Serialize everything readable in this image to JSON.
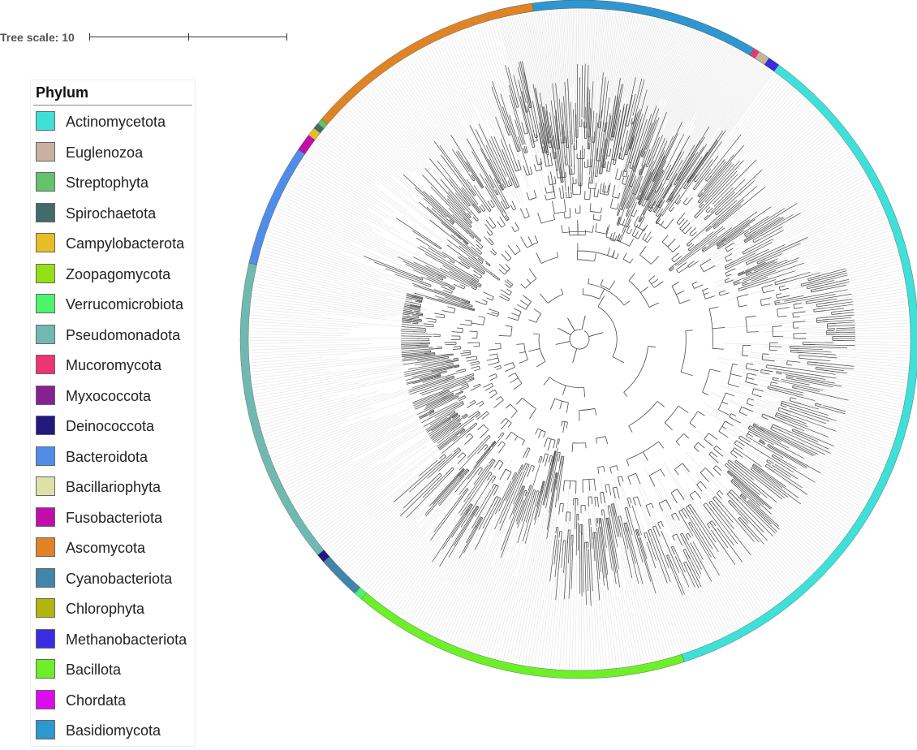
{
  "scale": {
    "label": "Tree scale: 10"
  },
  "legend": {
    "title": "Phylum",
    "items": [
      {
        "label": "Actinomycetota",
        "color": "#3ee0d8"
      },
      {
        "label": "Euglenozoa",
        "color": "#c7b29f"
      },
      {
        "label": "Streptophyta",
        "color": "#64c26a"
      },
      {
        "label": "Spirochaetota",
        "color": "#426b6b"
      },
      {
        "label": "Campylobacterota",
        "color": "#e6bd26"
      },
      {
        "label": "Zoopagomycota",
        "color": "#93e016"
      },
      {
        "label": "Verrucomicrobiota",
        "color": "#4cf46a"
      },
      {
        "label": "Pseudomonadota",
        "color": "#70b9b1"
      },
      {
        "label": "Mucoromycota",
        "color": "#ec3573"
      },
      {
        "label": "Myxococcota",
        "color": "#852292"
      },
      {
        "label": "Deinococcota",
        "color": "#24187d"
      },
      {
        "label": "Bacteroidota",
        "color": "#4f8de9"
      },
      {
        "label": "Bacillariophyta",
        "color": "#dee1a7"
      },
      {
        "label": "Fusobacteriota",
        "color": "#bf0ea9"
      },
      {
        "label": "Ascomycota",
        "color": "#df8327"
      },
      {
        "label": "Cyanobacteriota",
        "color": "#4185aa"
      },
      {
        "label": "Chlorophyta",
        "color": "#b4b40e"
      },
      {
        "label": "Methanobacteriota",
        "color": "#3a2ce0"
      },
      {
        "label": "Bacillota",
        "color": "#6def2a"
      },
      {
        "label": "Chordata",
        "color": "#dc0cec"
      },
      {
        "label": "Basidiomycota",
        "color": "#2e97d0"
      }
    ]
  },
  "ring_segments": [
    {
      "phylum": "Actinomycetota",
      "start_deg": 256,
      "end_deg": 432
    },
    {
      "phylum": "Bacillota",
      "start_deg": 432,
      "end_deg": 490
    },
    {
      "phylum": "Verrucomicrobiota",
      "start_deg": 490,
      "end_deg": 491.5
    },
    {
      "phylum": "Cyanobacteriota",
      "start_deg": 491.5,
      "end_deg": 499
    },
    {
      "phylum": "Deinococcota",
      "start_deg": 499,
      "end_deg": 500.5
    },
    {
      "phylum": "Pseudomonadota",
      "start_deg": 500.5,
      "end_deg": 553
    },
    {
      "phylum": "Bacteroidota",
      "start_deg": 553,
      "end_deg": 574
    },
    {
      "phylum": "Fusobacteriota",
      "start_deg": 574,
      "end_deg": 577
    },
    {
      "phylum": "Campylobacterota",
      "start_deg": 577,
      "end_deg": 578.5
    },
    {
      "phylum": "Spirochaetota",
      "start_deg": 578.5,
      "end_deg": 579.5
    },
    {
      "phylum": "Streptophyta",
      "start_deg": 579.5,
      "end_deg": 580.5
    },
    {
      "phylum": "Ascomycota",
      "start_deg": 580.5,
      "end_deg": 622
    },
    {
      "phylum": "Basidiomycota",
      "start_deg": 622,
      "end_deg": 661
    },
    {
      "phylum": "Mucoromycota",
      "start_deg": 661,
      "end_deg": 662
    },
    {
      "phylum": "Euglenozoa",
      "start_deg": 662,
      "end_deg": 664
    },
    {
      "phylum": "Methanobacteriota",
      "start_deg": 664,
      "end_deg": 666
    }
  ]
}
